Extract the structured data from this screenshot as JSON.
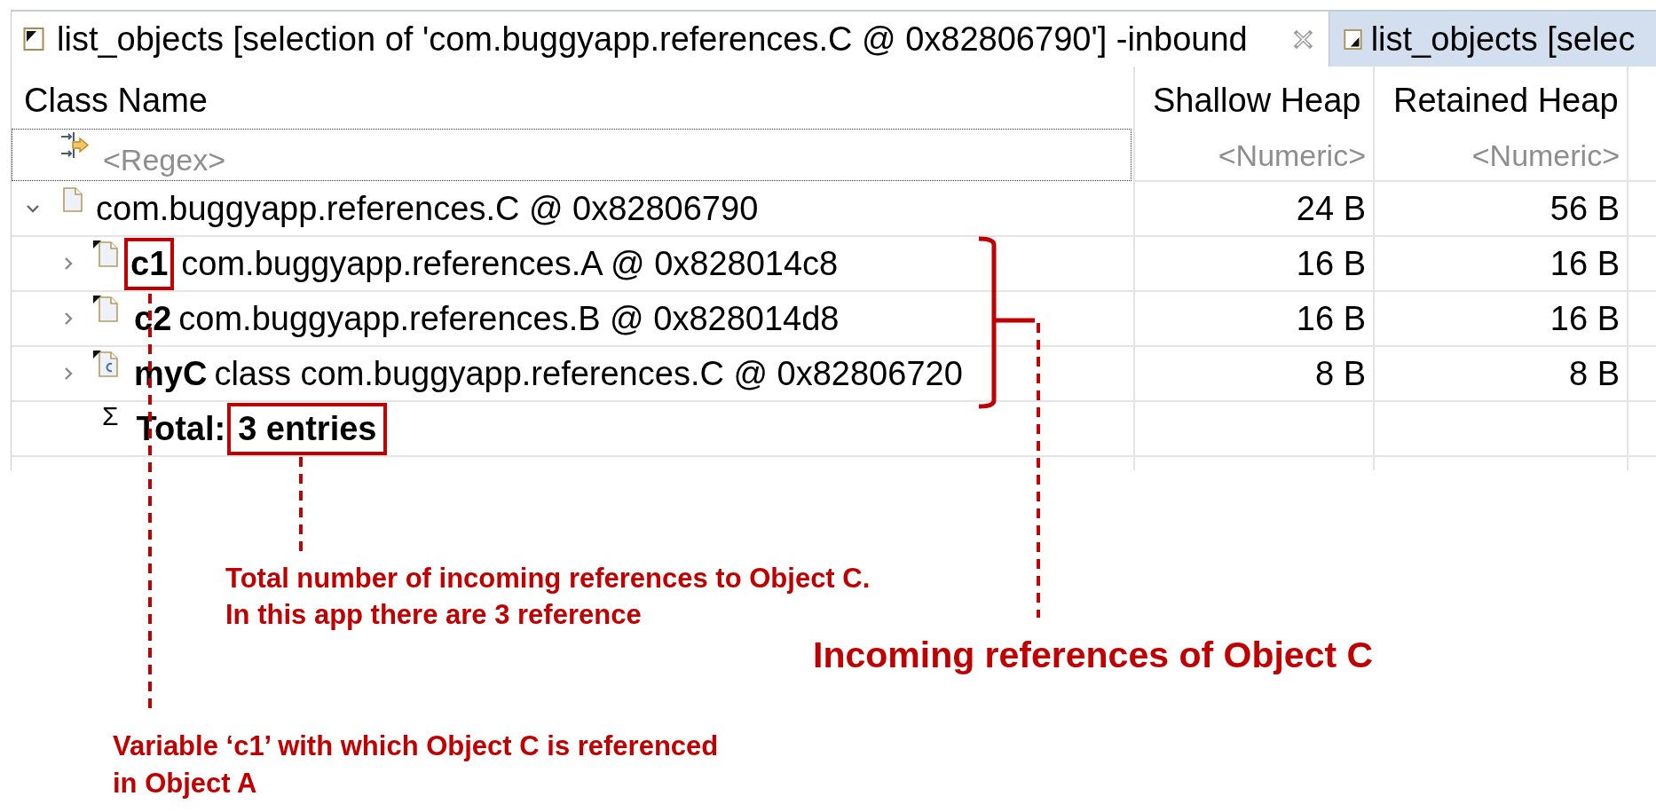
{
  "tabs": [
    {
      "label": "list_objects [selection of 'com.buggyapp.references.C @ 0x82806790'] -inbound",
      "selected": true,
      "kind": "inbound"
    },
    {
      "label": "list_objects [selec",
      "selected": false,
      "kind": "outbound"
    }
  ],
  "table": {
    "columns": [
      "Class Name",
      "Shallow Heap",
      "Retained Heap"
    ],
    "filters": [
      {
        "placeholder": "<Regex>"
      },
      {
        "placeholder": "<Numeric>"
      },
      {
        "placeholder": "<Numeric>"
      }
    ],
    "rows": [
      {
        "kind": "object",
        "name": "com.buggyapp.references.C @ 0x82806790",
        "shallow_heap": "24 B",
        "retained_heap": "56 B",
        "expanded": true,
        "children": [
          {
            "kind": "reference",
            "field": "c1",
            "name": "com.buggyapp.references.A @ 0x828014c8",
            "shallow_heap": "16 B",
            "retained_heap": "16 B",
            "expanded": false,
            "highlighted": true
          },
          {
            "kind": "reference",
            "field": "c2",
            "name": "com.buggyapp.references.B @ 0x828014d8",
            "shallow_heap": "16 B",
            "retained_heap": "16 B",
            "expanded": false,
            "highlighted": false
          },
          {
            "kind": "class",
            "field": "myC",
            "name": "class com.buggyapp.references.C @ 0x82806720",
            "shallow_heap": "8 B",
            "retained_heap": "8 B",
            "expanded": false,
            "highlighted": false
          },
          {
            "kind": "total",
            "symbol": "Σ",
            "label": "Total:",
            "value": "3 entries",
            "highlighted": true
          }
        ]
      }
    ]
  },
  "annotations": [
    {
      "kind": "total",
      "lines": [
        "Total number of incoming references to Object C.",
        "In this app there are 3 reference"
      ]
    },
    {
      "kind": "group",
      "lines": [
        "Incoming references of Object C"
      ]
    },
    {
      "kind": "field",
      "lines": [
        "Variable ‘c1’ with which Object C is referenced",
        "in Object A"
      ]
    }
  ]
}
